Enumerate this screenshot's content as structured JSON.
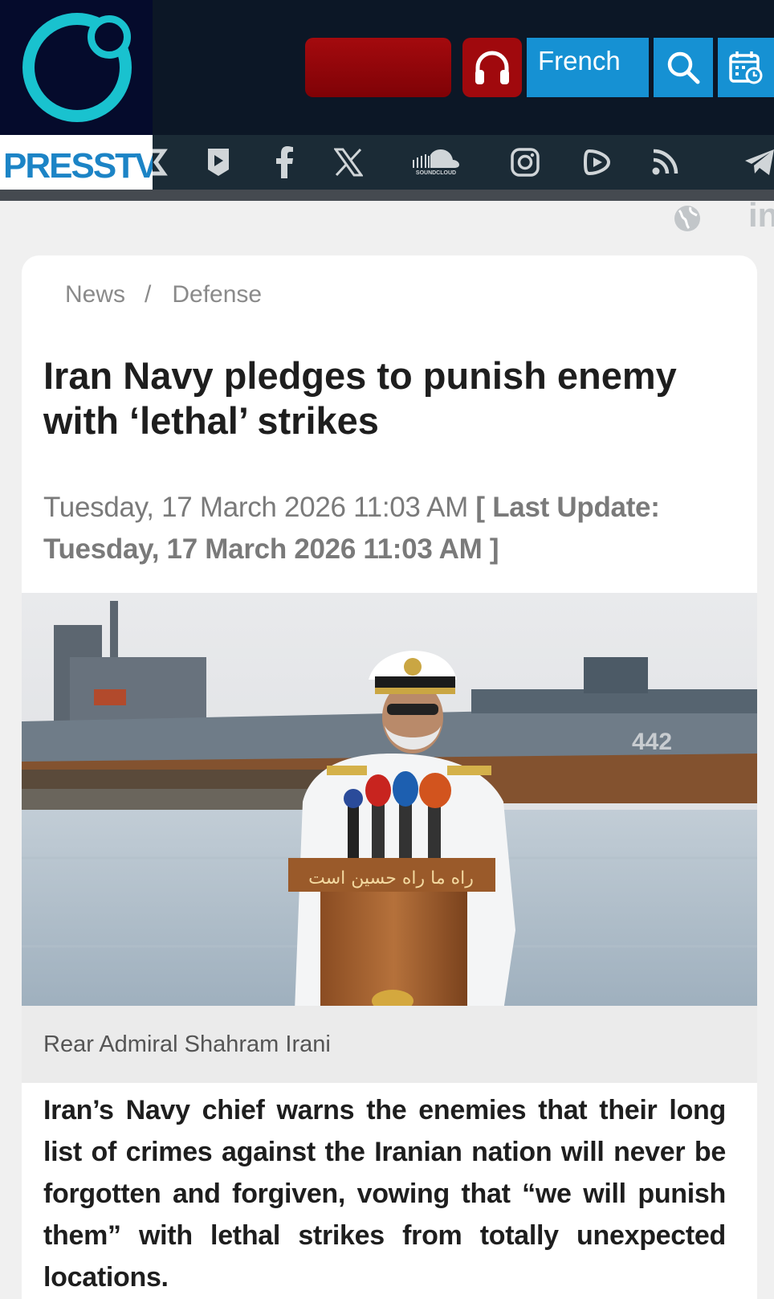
{
  "header": {
    "logo_text": "PRESSTV",
    "language_label": "French",
    "social_icons": [
      "youtube-icon",
      "facebook-icon",
      "x-icon",
      "soundcloud-icon",
      "instagram-icon",
      "rumble-icon",
      "rss-icon",
      "telegram-icon"
    ],
    "soundcloud_text": "SOUNDCLOUD",
    "accent_blue": "#1691d3",
    "live_red": "#a0090d"
  },
  "breadcrumb": {
    "home": "News",
    "separator": "/",
    "section": "Defense"
  },
  "article": {
    "title": "Iran Navy pledges to punish enemy with ‘lethal’ strikes",
    "date": "Tuesday, 17 March 2026 11:03 AM",
    "last_update": "[ Last Update: Tuesday, 17 March 2026 11:03 AM ]",
    "image_caption": "Rear Admiral Shahram Irani",
    "ship_number": "442",
    "podium_text": "راه ما راه حسین است",
    "lead": "Iran’s Navy chief warns the enemies that their long list of crimes against the Iranian nation will never be forgotten and forgiven, vowing that “we will punish them” with lethal strikes from totally unexpected locations."
  }
}
